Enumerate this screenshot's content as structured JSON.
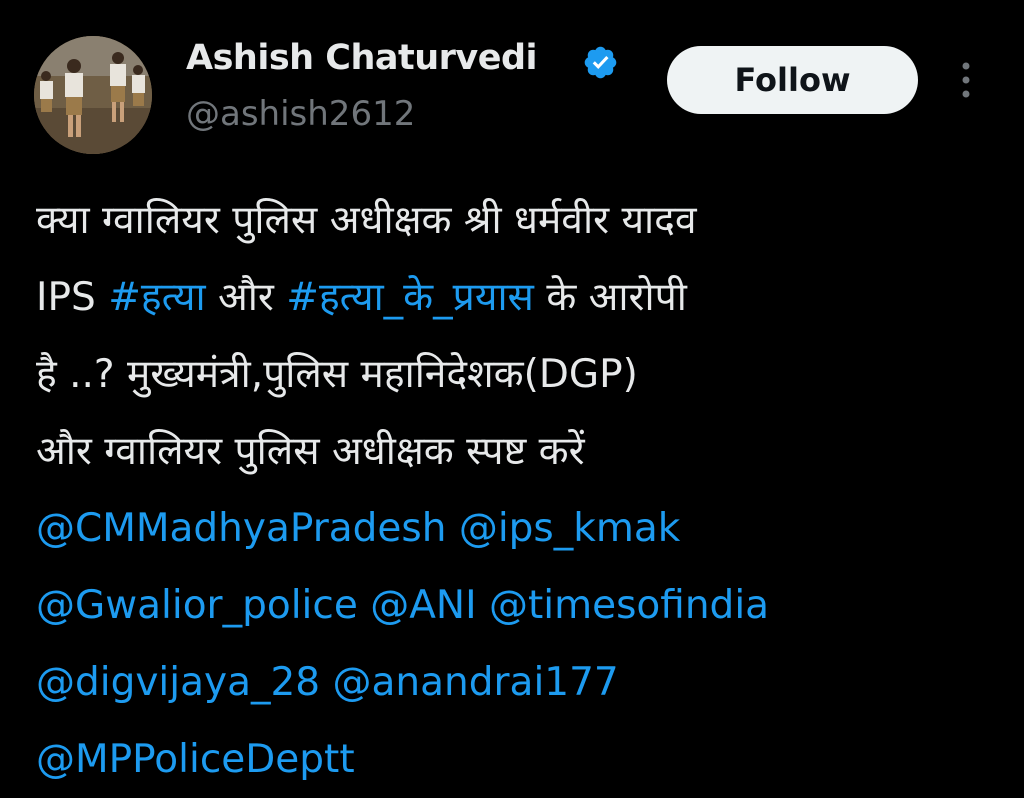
{
  "author": {
    "display_name": "Ashish Chaturvedi",
    "handle": "@ashish2612",
    "verified_icon": "verified-badge-icon",
    "avatar": "avatar-photo"
  },
  "actions": {
    "follow_label": "Follow",
    "more_icon": "more-vertical-icon"
  },
  "tweet": {
    "line1": "क्या ग्वालियर पुलिस अधीक्षक श्री धर्मवीर यादव",
    "line2_prefix": "IPS ",
    "hashtag1": "#हत्या",
    "line2_mid": " और ",
    "hashtag2": "#हत्या_के_प्रयास",
    "line2_suffix": " के आरोपी",
    "line3": "है ..?  मुख्यमंत्री,पुलिस महानिदेशक(DGP)",
    "line4": "और ग्वालियर पुलिस अधीक्षक स्पष्ट करें",
    "mentions": [
      "@CMMadhyaPradesh",
      "@ips_kmak",
      "@Gwalior_police",
      "@ANI",
      "@timesofindia",
      "@digvijaya_28",
      "@anandrai177",
      "@MPPoliceDeptt"
    ]
  },
  "colors": {
    "background": "#000000",
    "text": "#e7e9ea",
    "secondary": "#71767b",
    "link": "#1d9bf0",
    "button_bg": "#eff3f4"
  }
}
